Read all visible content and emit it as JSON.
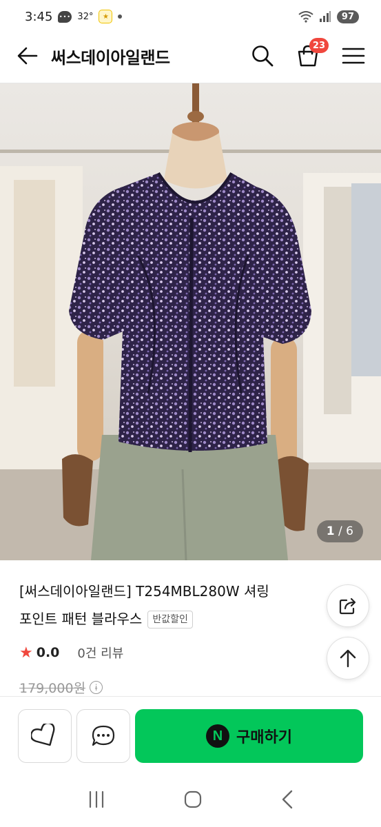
{
  "status": {
    "time": "3:45",
    "temperature": "32°",
    "chat_icon_text": "•••",
    "app_badge_text": "★",
    "battery": "97"
  },
  "header": {
    "title": "써스데이아일랜드",
    "cart_count": "23"
  },
  "image": {
    "current": "1",
    "separator": "/",
    "total": "6"
  },
  "product": {
    "title_line1": "[써스데이아일랜드] T254MBL280W 셔링",
    "title_line2": "포인트 패턴 블라우스",
    "half_price_badge": "반값할인",
    "star": "★",
    "rating": "0.0",
    "review_count": "0건 리뷰",
    "original_price": "179,000원",
    "info_symbol": "i"
  },
  "bottom": {
    "buy_label": "구매하기",
    "naver_letter": "N"
  },
  "colors": {
    "accent_green": "#03c75a",
    "badge_red": "#f0473d"
  }
}
